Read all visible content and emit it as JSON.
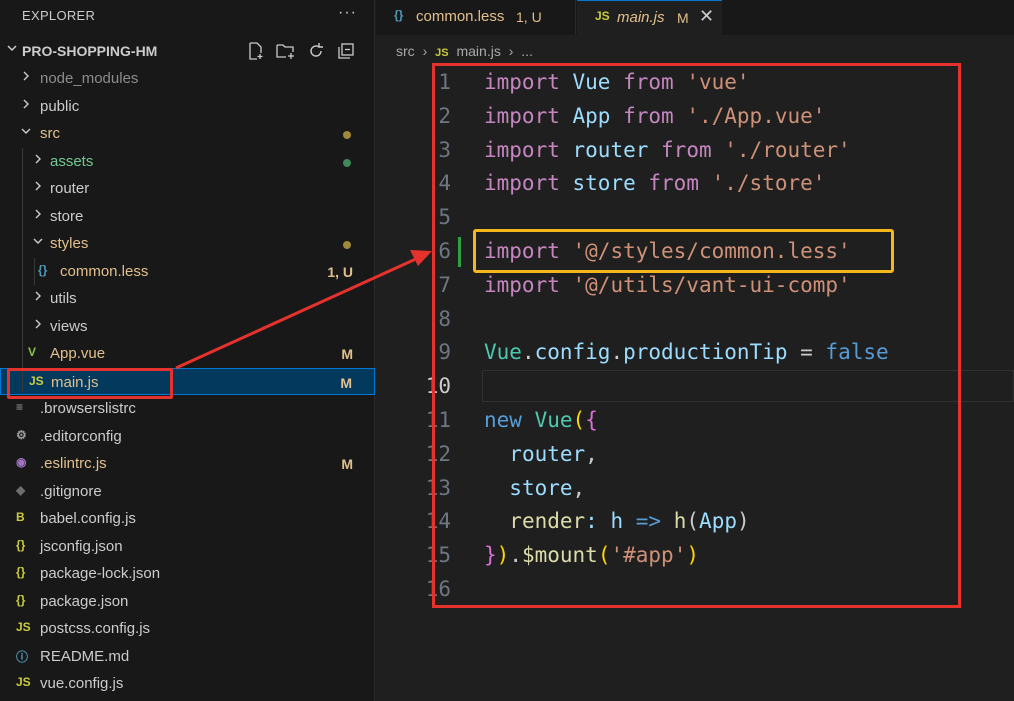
{
  "explorer": {
    "title": "EXPLORER",
    "more": "···",
    "project": "PRO-SHOPPING-HM"
  },
  "tree": [
    {
      "label": "node_modules",
      "type": "folder",
      "open": false,
      "color": "#8c8c8c",
      "badge": "",
      "dot": ""
    },
    {
      "label": "public",
      "type": "folder",
      "open": false,
      "color": "#cccccc",
      "badge": "",
      "dot": ""
    },
    {
      "label": "src",
      "type": "folder",
      "open": true,
      "color": "#e2c08d",
      "badge": "",
      "dot": "#a08a3a"
    },
    {
      "label": "assets",
      "type": "folder",
      "open": false,
      "color": "#73c991",
      "badge": "",
      "dot": "#3e8a58"
    },
    {
      "label": "router",
      "type": "folder",
      "open": false,
      "color": "#cccccc",
      "badge": "",
      "dot": ""
    },
    {
      "label": "store",
      "type": "folder",
      "open": false,
      "color": "#cccccc",
      "badge": "",
      "dot": ""
    },
    {
      "label": "styles",
      "type": "folder",
      "open": true,
      "color": "#e2c08d",
      "badge": "",
      "dot": "#a08a3a"
    },
    {
      "label": "common.less",
      "type": "file",
      "icon": "{}",
      "iconColor": "#519aba",
      "color": "#e2c08d",
      "badge": "1, U",
      "badgeColor": "#e2c08d",
      "dot": ""
    },
    {
      "label": "utils",
      "type": "folder",
      "open": false,
      "color": "#cccccc",
      "badge": "",
      "dot": ""
    },
    {
      "label": "views",
      "type": "folder",
      "open": false,
      "color": "#cccccc",
      "badge": "",
      "dot": ""
    },
    {
      "label": "App.vue",
      "type": "file",
      "icon": "V",
      "iconColor": "#8dc149",
      "color": "#e2c08d",
      "badge": "M",
      "badgeColor": "#e2c08d",
      "dot": ""
    },
    {
      "label": "main.js",
      "type": "file",
      "icon": "JS",
      "iconColor": "#cbcb41",
      "color": "#e2c08d",
      "badge": "M",
      "badgeColor": "#e2c08d",
      "dot": "",
      "selected": true
    },
    {
      "label": ".browserslistrc",
      "type": "file",
      "icon": "≡",
      "iconColor": "#9e9e9e",
      "color": "#cccccc",
      "badge": "",
      "dot": ""
    },
    {
      "label": ".editorconfig",
      "type": "file",
      "icon": "⚙",
      "iconColor": "#9e9e9e",
      "color": "#cccccc",
      "badge": "",
      "dot": ""
    },
    {
      "label": ".eslintrc.js",
      "type": "file",
      "icon": "◉",
      "iconColor": "#a074c4",
      "color": "#e2c08d",
      "badge": "M",
      "badgeColor": "#e2c08d",
      "dot": ""
    },
    {
      "label": ".gitignore",
      "type": "file",
      "icon": "◆",
      "iconColor": "#6d6d6d",
      "color": "#cccccc",
      "badge": "",
      "dot": ""
    },
    {
      "label": "babel.config.js",
      "type": "file",
      "icon": "B",
      "iconColor": "#cbcb41",
      "color": "#cccccc",
      "badge": "",
      "dot": ""
    },
    {
      "label": "jsconfig.json",
      "type": "file",
      "icon": "{}",
      "iconColor": "#cbcb41",
      "color": "#cccccc",
      "badge": "",
      "dot": ""
    },
    {
      "label": "package-lock.json",
      "type": "file",
      "icon": "{}",
      "iconColor": "#cbcb41",
      "color": "#cccccc",
      "badge": "",
      "dot": ""
    },
    {
      "label": "package.json",
      "type": "file",
      "icon": "{}",
      "iconColor": "#cbcb41",
      "color": "#cccccc",
      "badge": "",
      "dot": ""
    },
    {
      "label": "postcss.config.js",
      "type": "file",
      "icon": "JS",
      "iconColor": "#cbcb41",
      "color": "#cccccc",
      "badge": "",
      "dot": ""
    },
    {
      "label": "README.md",
      "type": "file",
      "icon": "ⓘ",
      "iconColor": "#519aba",
      "color": "#cccccc",
      "badge": "",
      "dot": ""
    },
    {
      "label": "vue.config.js",
      "type": "file",
      "icon": "JS",
      "iconColor": "#cbcb41",
      "color": "#cccccc",
      "badge": "",
      "dot": ""
    }
  ],
  "tabs": [
    {
      "icon": "{}",
      "label": "common.less",
      "status": "1, U"
    },
    {
      "icon": "JS",
      "label": "main.js",
      "status": "M",
      "close": "✕"
    }
  ],
  "breadcrumb": {
    "folder": "src",
    "sep": "›",
    "file_icon": "JS",
    "file": "main.js",
    "more": "..."
  },
  "code": [
    {
      "n": "1",
      "tokens": [
        [
          "kw",
          "import"
        ],
        [
          "pl",
          " "
        ],
        [
          "id",
          "Vue"
        ],
        [
          "pl",
          " "
        ],
        [
          "kw",
          "from"
        ],
        [
          "pl",
          " "
        ],
        [
          "str",
          "'vue'"
        ]
      ]
    },
    {
      "n": "2",
      "tokens": [
        [
          "kw",
          "import"
        ],
        [
          "pl",
          " "
        ],
        [
          "id",
          "App"
        ],
        [
          "pl",
          " "
        ],
        [
          "kw",
          "from"
        ],
        [
          "pl",
          " "
        ],
        [
          "str",
          "'./App.vue'"
        ]
      ]
    },
    {
      "n": "3",
      "tokens": [
        [
          "kw",
          "import"
        ],
        [
          "pl",
          " "
        ],
        [
          "id",
          "router"
        ],
        [
          "pl",
          " "
        ],
        [
          "kw",
          "from"
        ],
        [
          "pl",
          " "
        ],
        [
          "str",
          "'./router'"
        ]
      ]
    },
    {
      "n": "4",
      "tokens": [
        [
          "kw",
          "import"
        ],
        [
          "pl",
          " "
        ],
        [
          "id",
          "store"
        ],
        [
          "pl",
          " "
        ],
        [
          "kw",
          "from"
        ],
        [
          "pl",
          " "
        ],
        [
          "str",
          "'./store'"
        ]
      ]
    },
    {
      "n": "5",
      "tokens": []
    },
    {
      "n": "6",
      "tokens": [
        [
          "kw",
          "import"
        ],
        [
          "pl",
          " "
        ],
        [
          "str",
          "'@/styles/common.less'"
        ]
      ]
    },
    {
      "n": "7",
      "tokens": [
        [
          "kw",
          "import"
        ],
        [
          "pl",
          " "
        ],
        [
          "str",
          "'@/utils/vant-ui-comp'"
        ]
      ]
    },
    {
      "n": "8",
      "tokens": []
    },
    {
      "n": "9",
      "tokens": [
        [
          "cls",
          "Vue"
        ],
        [
          "pl",
          "."
        ],
        [
          "id",
          "config"
        ],
        [
          "pl",
          "."
        ],
        [
          "id",
          "productionTip"
        ],
        [
          "pl",
          " = "
        ],
        [
          "blu",
          "false"
        ]
      ]
    },
    {
      "n": "10",
      "tokens": []
    },
    {
      "n": "11",
      "tokens": [
        [
          "blu",
          "new"
        ],
        [
          "pl",
          " "
        ],
        [
          "cls",
          "Vue"
        ],
        [
          "br1",
          "("
        ],
        [
          "br2",
          "{"
        ]
      ]
    },
    {
      "n": "12",
      "tokens": [
        [
          "pl",
          "  "
        ],
        [
          "id",
          "router"
        ],
        [
          "pl",
          ","
        ]
      ]
    },
    {
      "n": "13",
      "tokens": [
        [
          "pl",
          "  "
        ],
        [
          "id",
          "store"
        ],
        [
          "pl",
          ","
        ]
      ]
    },
    {
      "n": "14",
      "tokens": [
        [
          "pl",
          "  "
        ],
        [
          "fn",
          "render"
        ],
        [
          "id",
          ":"
        ],
        [
          "pl",
          " "
        ],
        [
          "id",
          "h"
        ],
        [
          "pl",
          " "
        ],
        [
          "blu",
          "=>"
        ],
        [
          "pl",
          " "
        ],
        [
          "fn",
          "h"
        ],
        [
          "pl",
          "("
        ],
        [
          "id",
          "App"
        ],
        [
          "pl",
          ")"
        ]
      ]
    },
    {
      "n": "15",
      "tokens": [
        [
          "br2",
          "}"
        ],
        [
          "br1",
          ")"
        ],
        [
          "pl",
          "."
        ],
        [
          "fn",
          "$mount"
        ],
        [
          "br1",
          "("
        ],
        [
          "str",
          "'#app'"
        ],
        [
          "br1",
          ")"
        ]
      ]
    },
    {
      "n": "16",
      "tokens": []
    }
  ],
  "colors": {
    "red": "#e5322d",
    "yellow": "#f5b81c",
    "accent": "#0078d4"
  }
}
